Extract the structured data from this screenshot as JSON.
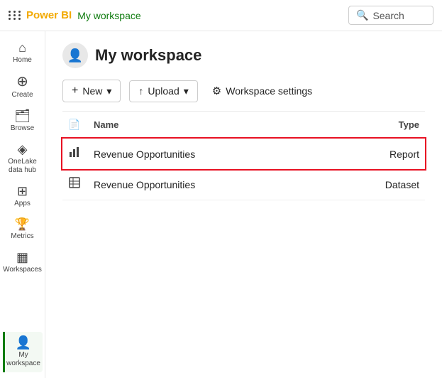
{
  "topbar": {
    "app_name": "Power BI",
    "workspace_link": "My workspace",
    "search_placeholder": "Search"
  },
  "sidebar": {
    "items": [
      {
        "id": "home",
        "label": "Home",
        "icon": "⌂"
      },
      {
        "id": "create",
        "label": "Create",
        "icon": "+"
      },
      {
        "id": "browse",
        "label": "Browse",
        "icon": "📁"
      },
      {
        "id": "onelake",
        "label": "OneLake data hub",
        "icon": "◈"
      },
      {
        "id": "apps",
        "label": "Apps",
        "icon": "⊞"
      },
      {
        "id": "metrics",
        "label": "Metrics",
        "icon": "🏆"
      },
      {
        "id": "workspaces",
        "label": "Workspaces",
        "icon": "▦"
      }
    ],
    "active_bottom": {
      "id": "my-workspace",
      "label": "My workspace",
      "icon": "👤"
    }
  },
  "workspace": {
    "title": "My workspace",
    "toolbar": {
      "new_label": "New",
      "upload_label": "Upload",
      "settings_label": "Workspace settings"
    },
    "table": {
      "col_name": "Name",
      "col_type": "Type",
      "rows": [
        {
          "id": "row1",
          "name": "Revenue Opportunities",
          "type": "Report",
          "icon": "report",
          "highlighted": true
        },
        {
          "id": "row2",
          "name": "Revenue Opportunities",
          "type": "Dataset",
          "icon": "dataset",
          "highlighted": false
        }
      ]
    }
  }
}
